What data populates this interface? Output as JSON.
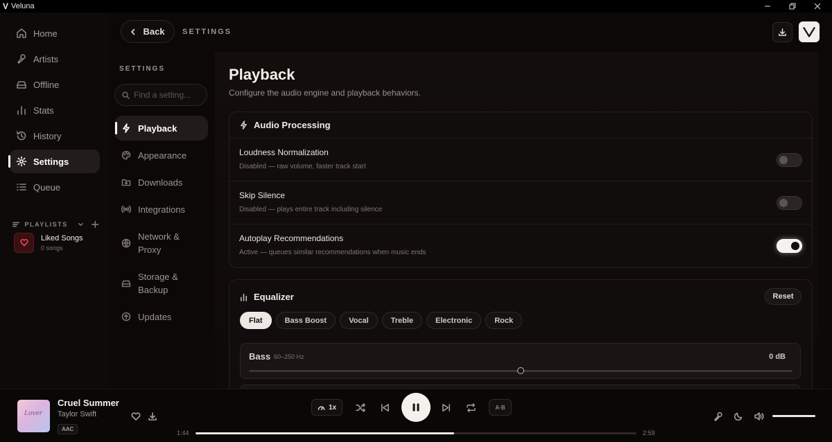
{
  "app": {
    "title": "Veluna",
    "logo_letter": "V"
  },
  "sidebar": {
    "items": [
      {
        "label": "Home",
        "icon": "home-icon"
      },
      {
        "label": "Artists",
        "icon": "mic-icon"
      },
      {
        "label": "Offline",
        "icon": "drive-icon"
      },
      {
        "label": "Stats",
        "icon": "bar-chart-icon"
      },
      {
        "label": "History",
        "icon": "history-icon"
      },
      {
        "label": "Settings",
        "icon": "gear-icon",
        "active": true
      },
      {
        "label": "Queue",
        "icon": "list-icon"
      }
    ],
    "playlists_label": "PLAYLISTS",
    "playlists": [
      {
        "name": "Liked Songs",
        "count": "0 songs"
      }
    ]
  },
  "topbar": {
    "back_label": "Back",
    "title": "SETTINGS"
  },
  "settings_menu": {
    "label": "SETTINGS",
    "search_placeholder": "Find a setting...",
    "items": [
      {
        "label": "Playback",
        "icon": "bolt-icon",
        "active": true
      },
      {
        "label": "Appearance",
        "icon": "palette-icon"
      },
      {
        "label": "Downloads",
        "icon": "folder-icon"
      },
      {
        "label": "Integrations",
        "icon": "broadcast-icon"
      },
      {
        "label": "Network & Proxy",
        "icon": "globe-icon"
      },
      {
        "label": "Storage & Backup",
        "icon": "storage-icon"
      },
      {
        "label": "Updates",
        "icon": "update-icon"
      }
    ]
  },
  "page": {
    "title": "Playback",
    "subtitle": "Configure the audio engine and playback behaviors.",
    "audio_processing": {
      "title": "Audio Processing",
      "rows": [
        {
          "title": "Loudness Normalization",
          "desc": "Disabled — raw volume, faster track start",
          "on": false
        },
        {
          "title": "Skip Silence",
          "desc": "Disabled — plays entire track including silence",
          "on": false
        },
        {
          "title": "Autoplay Recommendations",
          "desc": "Active — queues similar recommendations when music ends",
          "on": true
        }
      ]
    },
    "equalizer": {
      "title": "Equalizer",
      "reset_label": "Reset",
      "presets": [
        "Flat",
        "Bass Boost",
        "Vocal",
        "Treble",
        "Electronic",
        "Rock"
      ],
      "active_preset": "Flat",
      "bands": [
        {
          "name": "Bass",
          "range": "60–250 Hz",
          "value_label": "0 dB",
          "level": 0.5
        }
      ]
    }
  },
  "player": {
    "song": "Cruel Summer",
    "artist": "Taylor Swift",
    "album_art_text": "Lover",
    "codec": "AAC",
    "speed": "1x",
    "ab_label": "A·B",
    "elapsed": "1:44",
    "duration": "2:59",
    "progress": 0.586,
    "volume": 1.0
  },
  "colors": {
    "accent": "#f4f0eb",
    "background": "#0b0807",
    "liked": "#e04a55"
  }
}
